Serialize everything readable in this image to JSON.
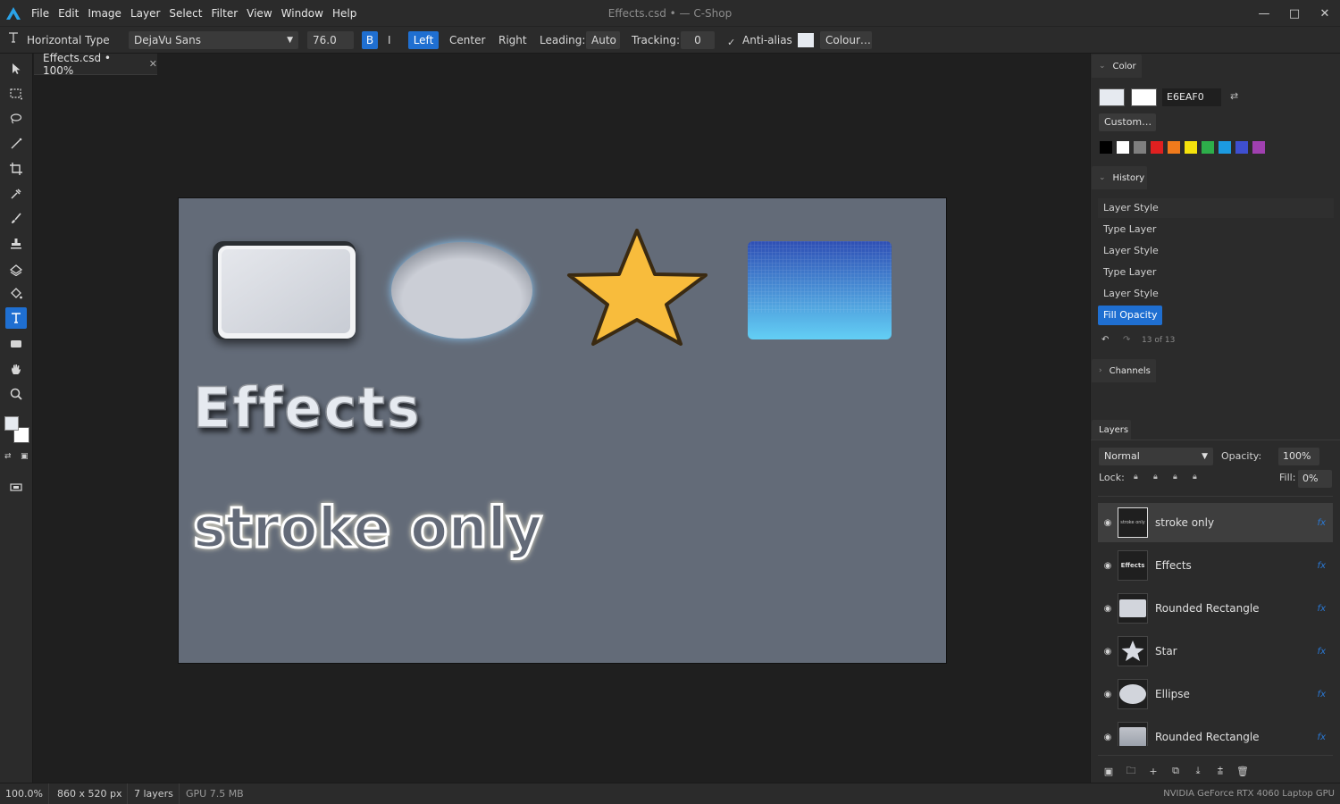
{
  "app": {
    "logo": "app-logo-icon",
    "menu": [
      "File",
      "Edit",
      "Image",
      "Layer",
      "Select",
      "Filter",
      "View",
      "Window",
      "Help"
    ],
    "window_title": "Effects.csd • — C-Shop",
    "controls": [
      "minimize-icon",
      "maximize-icon",
      "close-icon"
    ]
  },
  "options": {
    "tool_name": "Horizontal Type",
    "font_family": "DejaVu Sans",
    "font_size": "76.0 px",
    "bold": "B",
    "italic": "I",
    "align_left": "Left",
    "align_center": "Center",
    "align_right": "Right",
    "leading_label": "Leading:",
    "leading_value": "Auto",
    "tracking_label": "Tracking:",
    "tracking_value": "0",
    "antialias_label": "Anti-alias",
    "antialias_checked": true,
    "colour_button": "Colour…",
    "text_color": "#E6EAF0"
  },
  "document": {
    "tab_label": "Effects.csd • 100%",
    "canvas_bg": "#636B78",
    "texts": {
      "effects": "Effects",
      "stroke": "stroke only"
    },
    "shapes": {
      "rect_fill": "#D2D5DC",
      "ellipse_fill": "#CBCED6",
      "star_fill": "#F8BC3C",
      "star_stroke": "#3A2A12",
      "gradient_top": "#2E4FB5",
      "gradient_bottom": "#63CFF5"
    }
  },
  "color_panel": {
    "title": "Color",
    "fg_color": "#E6EAF0",
    "bg_color": "#FFFFFF",
    "hex": "E6EAF0",
    "custom_button": "Custom…",
    "palette": [
      "#000000",
      "#FFFFFF",
      "#7F7F7F",
      "#E02020",
      "#F07A1C",
      "#F5E20C",
      "#2DAE4A",
      "#1C9AE0",
      "#3E4FD0",
      "#A040B0"
    ]
  },
  "history_panel": {
    "title": "History",
    "items": [
      "Layer Style",
      "Type Layer",
      "Layer Style",
      "Type Layer",
      "Layer Style",
      "Fill Opacity"
    ],
    "selected_index": 5,
    "count": "13 of 13"
  },
  "channels_panel": {
    "title": "Channels"
  },
  "layers_panel": {
    "title": "Layers",
    "blend_mode": "Normal",
    "opacity_label": "Opacity:",
    "opacity_value": "100%",
    "lock_label": "Lock:",
    "fill_label": "Fill:",
    "fill_value": "0%",
    "fx_label": "fx",
    "layers": [
      {
        "name": "stroke only",
        "thumb_text": "stroke only",
        "selected": true
      },
      {
        "name": "Effects",
        "thumb_text": "Effects",
        "selected": false
      },
      {
        "name": "Rounded Rectangle",
        "thumb_text": "",
        "selected": false
      },
      {
        "name": "Star",
        "thumb_text": "",
        "selected": false
      },
      {
        "name": "Ellipse",
        "thumb_text": "",
        "selected": false
      },
      {
        "name": "Rounded Rectangle",
        "thumb_text": "",
        "selected": false
      }
    ]
  },
  "status": {
    "zoom": "100.0%",
    "size": "860 x 520 px",
    "layers": "7 layers",
    "gpu_mem": "GPU 7.5 MB",
    "gpu_name": "NVIDIA GeForce RTX 4060 Laptop GPU"
  }
}
